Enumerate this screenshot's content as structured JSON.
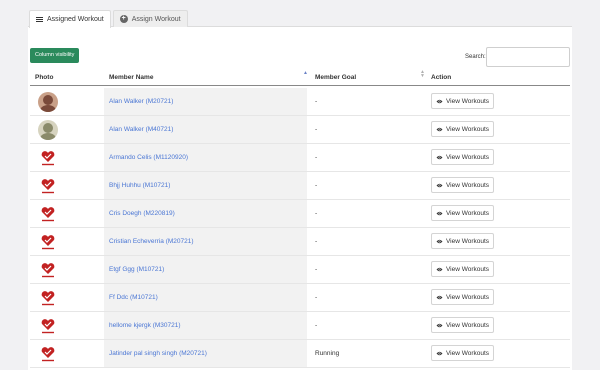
{
  "tabs": [
    {
      "label": "Assigned Workout",
      "icon": "hamburger-icon",
      "active": true
    },
    {
      "label": "Assign Workout",
      "icon": "plus-circle-icon",
      "active": false
    }
  ],
  "toolbar": {
    "column_visibility_label": "Column visibility",
    "search_label": "Search:",
    "search_value": ""
  },
  "table": {
    "headers": [
      "Photo",
      "Member Name",
      "Member Goal",
      "Action"
    ],
    "rows": [
      {
        "photo": "avatar-photo",
        "name": "Alan Walker (M20721)",
        "goal": "-",
        "action": "View Workouts"
      },
      {
        "photo": "avatar-photo",
        "name": "Alan Walker (M40721)",
        "goal": "-",
        "action": "View Workouts"
      },
      {
        "photo": "logo",
        "name": "Armando Celis (M1120920)",
        "goal": "-",
        "action": "View Workouts"
      },
      {
        "photo": "logo",
        "name": "Bhjj Huhhu (M10721)",
        "goal": "-",
        "action": "View Workouts"
      },
      {
        "photo": "logo",
        "name": "Cris Doegh (M220819)",
        "goal": "-",
        "action": "View Workouts"
      },
      {
        "photo": "logo",
        "name": "Cristian Echeverria (M20721)",
        "goal": "-",
        "action": "View Workouts"
      },
      {
        "photo": "logo",
        "name": "Etgf Ggg (M10721)",
        "goal": "-",
        "action": "View Workouts"
      },
      {
        "photo": "logo",
        "name": "Ff Ddc (M10721)",
        "goal": "-",
        "action": "View Workouts"
      },
      {
        "photo": "logo",
        "name": "hellome kjergk (M30721)",
        "goal": "-",
        "action": "View Workouts"
      },
      {
        "photo": "logo",
        "name": "Jatinder pal singh singh (M20721)",
        "goal": "Running",
        "action": "View Workouts"
      }
    ]
  },
  "colors": {
    "accent_green": "#2a8a5c",
    "link_blue": "#4a76d4",
    "logo_red": "#c22222"
  }
}
